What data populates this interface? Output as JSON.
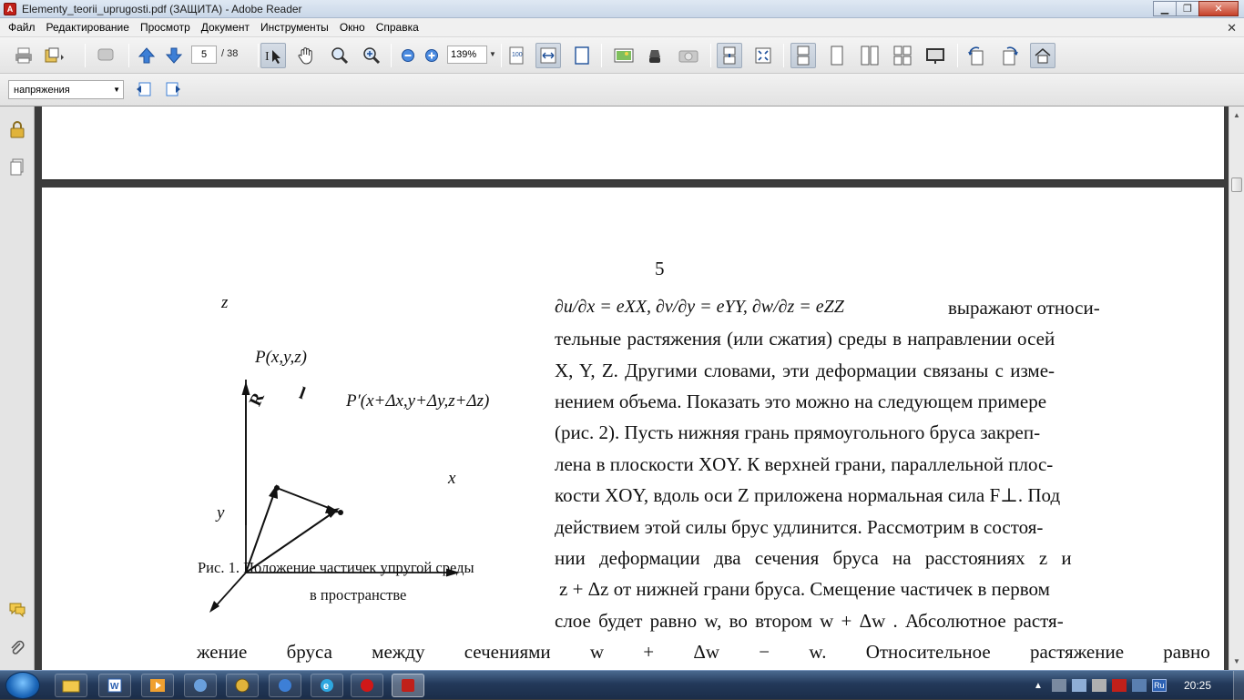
{
  "window": {
    "title": "Elementy_teorii_uprugosti.pdf (ЗАЩИТА) - Adobe Reader"
  },
  "menubar": {
    "items": [
      "Файл",
      "Редактирование",
      "Просмотр",
      "Документ",
      "Инструменты",
      "Окно",
      "Справка"
    ]
  },
  "toolbar": {
    "current_page": "5",
    "total_pages": "/ 38",
    "zoom": "139%"
  },
  "search": {
    "value": "напряжения"
  },
  "page": {
    "page_number": "5",
    "figure": {
      "axis_z": "z",
      "axis_x": "x",
      "axis_y": "y",
      "label_P": "P(x,y,z)",
      "label_P_prime": "P′(x+Δx,y+Δy,z+Δz)",
      "label_R": "R",
      "label_l": "l",
      "caption_line1": "Рис.  1. Положение частичек упругой среды",
      "caption_line2": "в пространстве"
    },
    "line1_math": "∂u/∂x = eXX,   ∂v/∂y = eYY,   ∂w/∂z = eZZ",
    "line1_text": "выражают относи-",
    "line2": "тельные растяжения (или сжатия) среды в направлении осей",
    "line3": "X, Y, Z. Другими словами, эти деформации связаны с изме-",
    "line4": "нением объема. Показать это можно на следующем примере",
    "line5": "(рис. 2). Пусть нижняя грань прямоугольного бруса закреп-",
    "line6": "лена в плоскости XOY. К верхней грани, параллельной плос-",
    "line7": "кости XOY, вдоль оси Z приложена нормальная сила F⊥. Под",
    "line8": "действием этой силы брус удлинится. Рассмотрим в состоя-",
    "line9": "нии деформации два сечения бруса на расстояниях z и",
    "line10": "z + Δz  от нижней грани бруса. Смещение частичек в первом",
    "line11": "слое будет равно w, во втором  w + Δw . Абсолютное растя-",
    "line12": "жение бруса между сечениями w + Δw − w. Относительное растяжение равно"
  },
  "taskbar": {
    "clock": "20:25",
    "language": "Ru"
  }
}
